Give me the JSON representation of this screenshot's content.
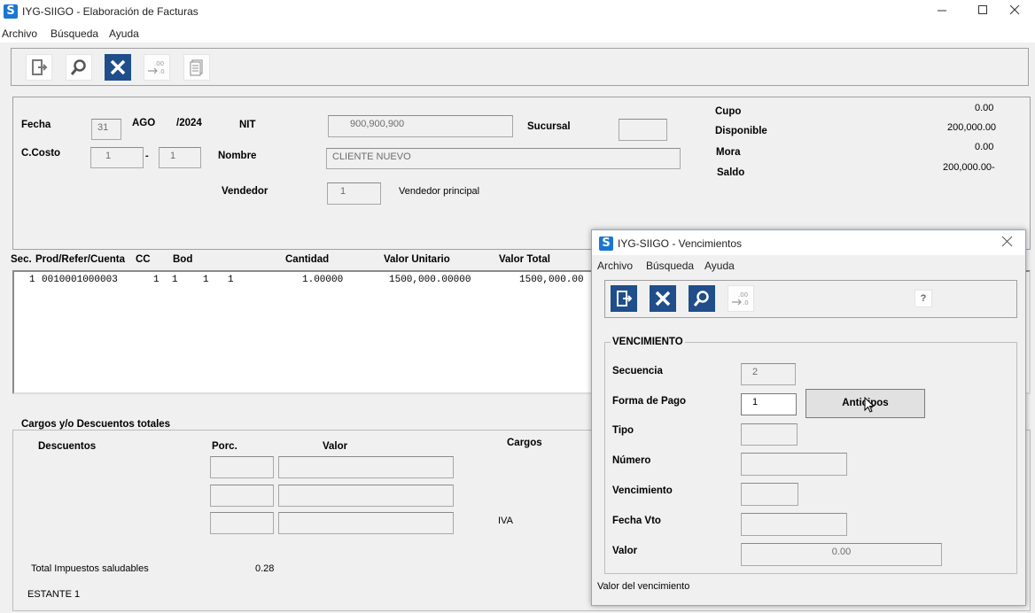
{
  "main": {
    "title": "IYG-SIIGO - Elaboración de Facturas",
    "menu": [
      "Archivo",
      "Búsqueda",
      "Ayuda"
    ],
    "toolbar_icons": [
      "exit-icon",
      "search-icon",
      "delete-icon",
      "decimals-icon",
      "document-icon"
    ],
    "header": {
      "fecha_label": "Fecha",
      "fecha_day": "31",
      "fecha_month": "AGO",
      "fecha_year": "/2024",
      "nit_label": "NIT",
      "nit_value": "900,900,900",
      "sucursal_label": "Sucursal",
      "sucursal_value": "",
      "ccosto_label": "C.Costo",
      "ccosto_value1": "1",
      "ccosto_sep": "-",
      "ccosto_value2": "1",
      "nombre_label": "Nombre",
      "nombre_value": "CLIENTE NUEVO",
      "vendedor_label": "Vendedor",
      "vendedor_value": "1",
      "vendedor_name": "Vendedor principal"
    },
    "summary": {
      "cupo_label": "Cupo",
      "cupo_value": "0.00",
      "disponible_label": "Disponible",
      "disponible_value": "200,000.00",
      "mora_label": "Mora",
      "mora_value": "0.00",
      "saldo_label": "Saldo",
      "saldo_value": "200,000.00-"
    },
    "grid": {
      "columns": [
        "Sec.",
        "Prod/Refer/Cuenta",
        "CC",
        "Bod",
        "Cantidad",
        "Valor Unitario",
        "Valor Total"
      ],
      "row": {
        "sec": "1",
        "prod": "0010001000003",
        "c1": "1",
        "c2": "1",
        "c3": "1",
        "c4": "1",
        "cantidad": "1.00000",
        "valor_unitario": "1500,000.00000",
        "valor_total": "1500,000.00"
      }
    },
    "cargos": {
      "group_title": "Cargos y/o Descuentos totales",
      "descuentos_label": "Descuentos",
      "porc_label": "Porc.",
      "valor_label": "Valor",
      "cargos_label": "Cargos",
      "iva_label": "IVA",
      "total_impuestos_label": "Total Impuestos saludables",
      "total_impuestos_value": "0.28",
      "estante_label": "ESTANTE 1"
    }
  },
  "dialog": {
    "title": "IYG-SIIGO - Vencimientos",
    "menu": [
      "Archivo",
      "Búsqueda",
      "Ayuda"
    ],
    "toolbar_icons": [
      "exit-icon",
      "delete-icon",
      "search-icon",
      "decimals-icon",
      "help-icon"
    ],
    "help_glyph": "?",
    "group_title": "VENCIMIENTO",
    "secuencia_label": "Secuencia",
    "secuencia_value": "2",
    "forma_pago_label": "Forma de Pago",
    "forma_pago_value": "1",
    "anticipos_button": "Anticipos",
    "tipo_label": "Tipo",
    "tipo_value": "",
    "numero_label": "Número",
    "numero_value": "",
    "vencimiento_label": "Vencimiento",
    "vencimiento_value": "",
    "fecha_vto_label": "Fecha Vto",
    "fecha_vto_value": "",
    "valor_label": "Valor",
    "valor_value": "0.00",
    "status_text": "Valor del vencimiento"
  },
  "colors": {
    "accent": "#1f4e8a",
    "logo": "#1976d2"
  }
}
